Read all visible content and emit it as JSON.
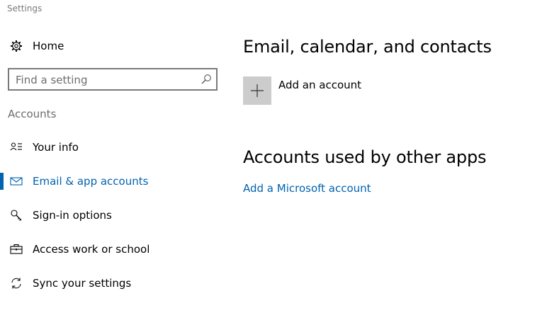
{
  "window": {
    "title": "Settings"
  },
  "sidebar": {
    "home_label": "Home",
    "search": {
      "placeholder": "Find a setting",
      "value": ""
    },
    "section_label": "Accounts",
    "items": [
      {
        "label": "Your info",
        "icon": "contact-card-icon",
        "active": false
      },
      {
        "label": "Email & app accounts",
        "icon": "mail-icon",
        "active": true
      },
      {
        "label": "Sign-in options",
        "icon": "key-icon",
        "active": false
      },
      {
        "label": "Access work or school",
        "icon": "briefcase-icon",
        "active": false
      },
      {
        "label": "Sync your settings",
        "icon": "sync-icon",
        "active": false
      }
    ]
  },
  "main": {
    "email_section_title": "Email, calendar, and contacts",
    "add_account_label": "Add an account",
    "other_apps_section_title": "Accounts used by other apps",
    "add_microsoft_account_link": "Add a Microsoft account"
  },
  "colors": {
    "accent": "#0063b1",
    "tile": "#cccccc",
    "muted_text": "#6d6d6d"
  }
}
